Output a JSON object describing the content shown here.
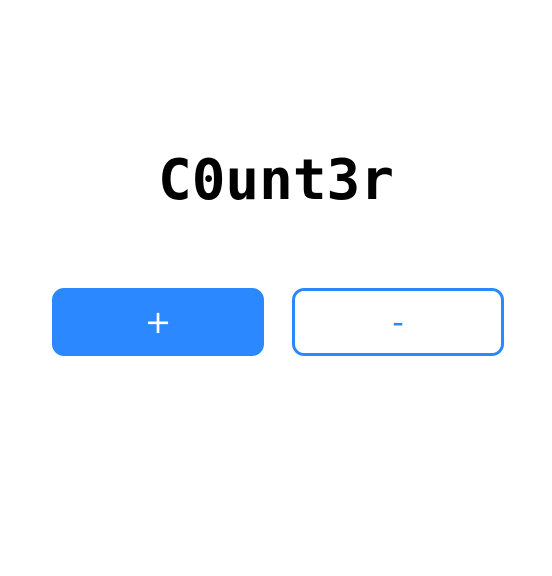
{
  "app": {
    "title": "C0unt3r"
  },
  "buttons": {
    "increment_label": "+",
    "decrement_label": "-"
  },
  "colors": {
    "accent": "#2b88ff",
    "background": "#ffffff",
    "title_text": "#000000"
  }
}
